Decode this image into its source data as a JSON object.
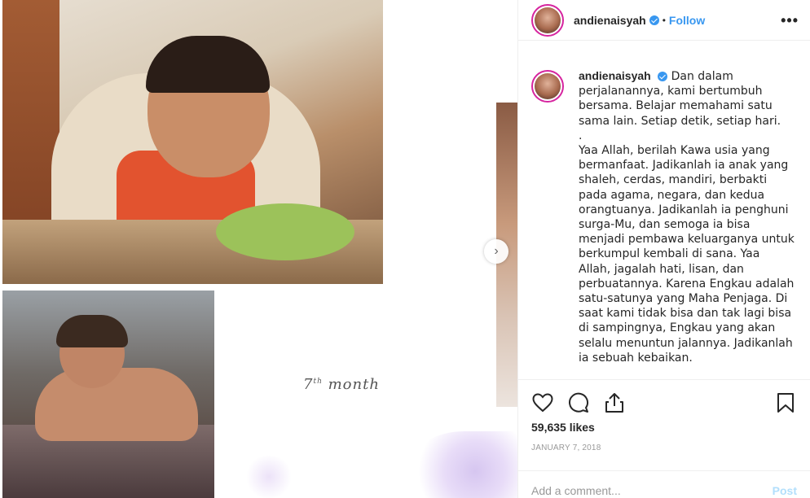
{
  "post": {
    "username": "andienaisyah",
    "follow_label": "Follow",
    "dot": "•",
    "more_label": "•••",
    "caption": "Dan dalam perjalanannya, kami bertumbuh bersama. Belajar memahami satu sama lain. Setiap detik, setiap hari.\n.\nYaa Allah, berilah Kawa usia yang bermanfaat. Jadikanlah ia anak yang shaleh, cerdas, mandiri, berbakti pada agama, negara, dan kedua orangtuanya. Jadikanlah ia penghuni surga-Mu, dan semoga ia bisa menjadi pembawa keluarganya untuk berkumpul kembali di sana. Yaa Allah, jagalah hati, lisan, dan perbuatannya. Karena Engkau adalah satu-satunya yang Maha Penjaga. Di saat kami tidak bisa dan tak lagi bisa di sampingnya, Engkau yang akan selalu menuntun jalannya. Jadikanlah ia sebuah kebaikan.",
    "likes": "59,635 likes",
    "date": "JANUARY 7, 2018",
    "comment_placeholder": "Add a comment...",
    "post_label": "Post"
  },
  "media": {
    "month_main": "7",
    "month_sup": "th",
    "month_word": "month",
    "next_arrow": "›"
  },
  "colors": {
    "accent": "#3897f0",
    "text": "#262626",
    "muted": "#999999"
  }
}
